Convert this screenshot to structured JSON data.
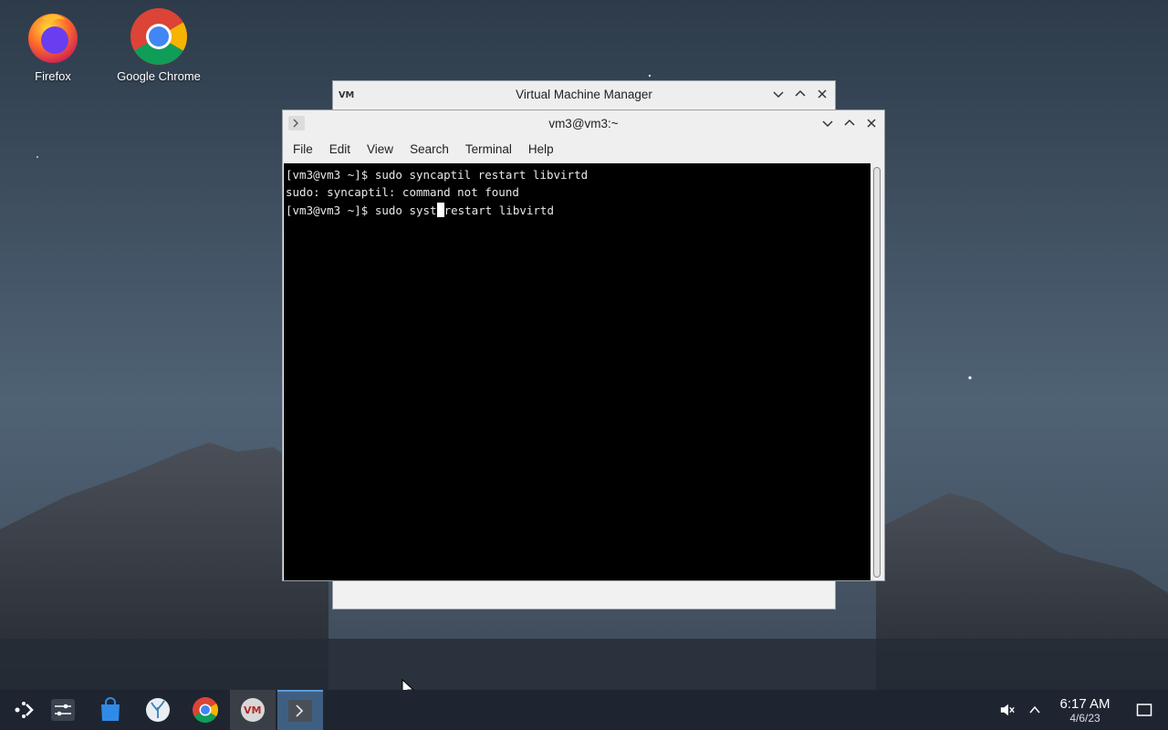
{
  "desktop": {
    "icons": [
      {
        "label": "Firefox"
      },
      {
        "label": "Google Chrome"
      }
    ]
  },
  "vmm_window": {
    "title": "Virtual Machine Manager",
    "icon": "vm-icon"
  },
  "terminal_window": {
    "title": "vm3@vm3:~",
    "menu": [
      "File",
      "Edit",
      "View",
      "Search",
      "Terminal",
      "Help"
    ],
    "lines": [
      "[vm3@vm3 ~]$ sudo syncaptil restart libvirtd",
      "sudo: syncaptil: command not found"
    ],
    "current_prompt": "[vm3@vm3 ~]$ sudo syst",
    "current_after_cursor": "restart libvirtd"
  },
  "taskbar": {
    "items": [
      "app-launcher",
      "system-settings",
      "discover-store",
      "flatpak-app",
      "google-chrome",
      "virt-manager",
      "terminal"
    ],
    "clock": {
      "time": "6:17 AM",
      "date": "4/6/23"
    }
  },
  "colors": {
    "taskbar_bg": "#1f2530",
    "active_task": "#3f5f82",
    "terminal_bg": "#000000"
  }
}
